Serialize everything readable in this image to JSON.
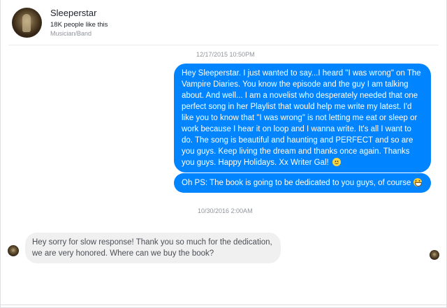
{
  "header": {
    "page_name": "Sleeperstar",
    "likes": "18K people like this",
    "category": "Musician/Band"
  },
  "conversation": {
    "timestamps": [
      "12/17/2015 10:50PM",
      "10/30/2016 2:00AM"
    ],
    "messages": [
      {
        "direction": "outgoing",
        "text": "Hey Sleeperstar. I just wanted to say...I heard \"I was wrong\" on The Vampire Diaries. You know the episode and the guy I am talking about. And well... I am a novelist who desperately needed that one perfect song in her Playlist that would help me write my latest. I'd like you to know that \"I was wrong\" is not letting me eat or sleep or work because I hear it on loop and I wanna write. It's all I want to do. The song is beautiful and haunting and PERFECT and so are you guys. Keep living the dream and thanks once again. Thanks you guys. Happy Holidays. Xx Writer Gal! ",
        "emoji": "slightly-smiling-face"
      },
      {
        "direction": "outgoing",
        "text": "Oh PS: The book is going to be dedicated to you guys, of course ",
        "emoji": "grinning-face"
      },
      {
        "direction": "incoming",
        "text": "Hey sorry for slow response! Thank you so much for the dedication, we are very honored. Where can we buy the book?"
      }
    ]
  },
  "colors": {
    "outgoing_bubble": "#0084ff",
    "incoming_bubble": "#f1f0f0",
    "meta_text": "#90949c"
  }
}
